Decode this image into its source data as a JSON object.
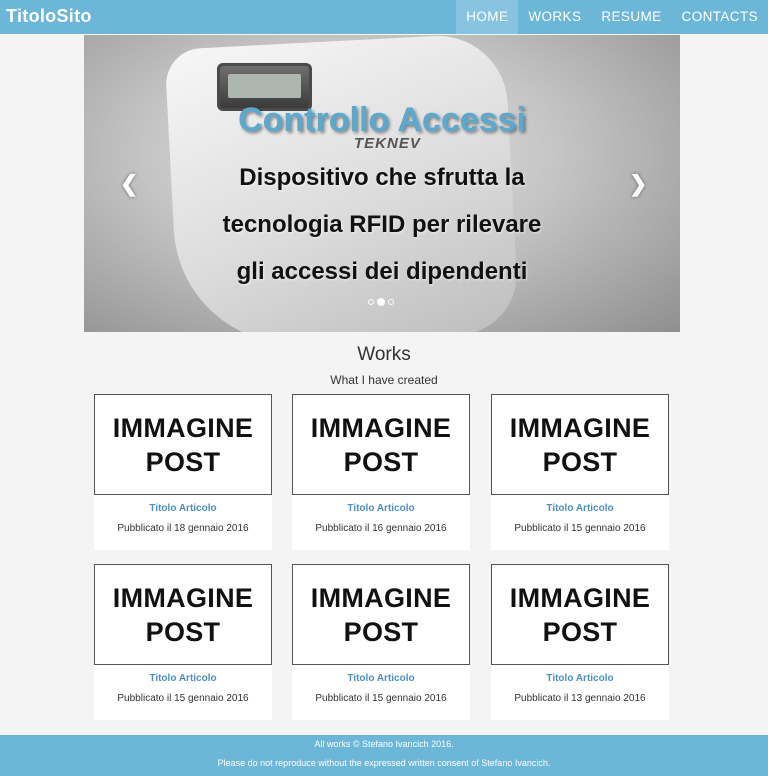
{
  "navbar": {
    "brand": "TitoloSito",
    "items": [
      {
        "label": "HOME",
        "active": true
      },
      {
        "label": "WORKS",
        "active": false
      },
      {
        "label": "RESUME",
        "active": false
      },
      {
        "label": "CONTACTS",
        "active": false
      }
    ]
  },
  "carousel": {
    "image": "device-image",
    "device_brand": "TEKNEV",
    "title": "Controllo Accessi",
    "caption_lines": [
      "Dispositivo che sfrutta la",
      "tecnologia RFID per rilevare",
      "gli accessi dei dipendenti"
    ],
    "prev_icon": "chevron-left-icon",
    "next_icon": "chevron-right-icon",
    "indicator_count": 3,
    "active_indicator": 2
  },
  "works": {
    "title": "Works",
    "subtitle": "What I have created",
    "cards": [
      {
        "img_line1": "IMMAGINE",
        "img_line2": "POST",
        "title": "Titolo Articolo",
        "date": "Pubblicato il 18 gennaio 2016"
      },
      {
        "img_line1": "IMMAGINE",
        "img_line2": "POST",
        "title": "Titolo Articolo",
        "date": "Pubblicato il 16 gennaio 2016"
      },
      {
        "img_line1": "IMMAGINE",
        "img_line2": "POST",
        "title": "Titolo Articolo",
        "date": "Pubblicato il 15 gennaio 2016"
      },
      {
        "img_line1": "IMMAGINE",
        "img_line2": "POST",
        "title": "Titolo Articolo",
        "date": "Pubblicato il 15 gennaio 2016"
      },
      {
        "img_line1": "IMMAGINE",
        "img_line2": "POST",
        "title": "Titolo Articolo",
        "date": "Pubblicato il 15 gennaio 2016"
      },
      {
        "img_line1": "IMMAGINE",
        "img_line2": "POST",
        "title": "Titolo Articolo",
        "date": "Pubblicato il 13 gennaio 2016"
      }
    ]
  },
  "footer": {
    "line1": "All works © Stefano Ivancich 2016.",
    "line2": "Please do not reproduce without the expressed written consent of Stefano Ivancich."
  },
  "colors": {
    "navbar": "#6cb6d8",
    "nav_active": "#86c4e2",
    "carousel_title": "#5aa9cf",
    "card_link": "#4d8fc0",
    "background": "#f4f4f4"
  }
}
